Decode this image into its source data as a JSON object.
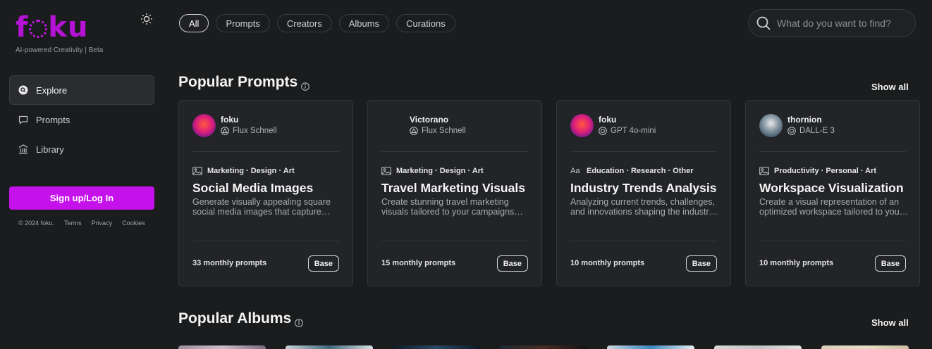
{
  "brand": {
    "logo_text_pre": "f",
    "logo_text_post": "ku",
    "tagline": "AI-powered Creativity | Beta",
    "accent": "#c511ea"
  },
  "sidebar": {
    "items": [
      {
        "label": "Explore",
        "icon": "explore-icon",
        "active": true
      },
      {
        "label": "Prompts",
        "icon": "chat-bubble-icon",
        "active": false
      },
      {
        "label": "Library",
        "icon": "library-icon",
        "active": false
      }
    ],
    "signup_label": "Sign up/Log In",
    "footer": {
      "copyright": "© 2024 foku.",
      "terms": "Terms",
      "privacy": "Privacy",
      "cookies": "Cookies"
    }
  },
  "tabs": [
    {
      "label": "All",
      "active": true
    },
    {
      "label": "Prompts",
      "active": false
    },
    {
      "label": "Creators",
      "active": false
    },
    {
      "label": "Albums",
      "active": false
    },
    {
      "label": "Curations",
      "active": false
    }
  ],
  "search": {
    "placeholder": "What do you want to find?"
  },
  "popular_prompts": {
    "title": "Popular Prompts",
    "show_all": "Show all",
    "cards": [
      {
        "author": "foku",
        "model": "Flux Schnell",
        "categories": "Marketing · Design · Art",
        "category_icon": "image-icon",
        "title": "Social Media Images",
        "description": "Generate visually appealing square social media images that capture attention and engage your audience",
        "monthly": "33 monthly prompts",
        "badge": "Base"
      },
      {
        "author": "Victorano",
        "model": "Flux Schnell",
        "categories": "Marketing · Design · Art",
        "category_icon": "image-icon",
        "title": "Travel Marketing Visuals",
        "description": "Create stunning travel marketing visuals tailored to your campaigns and destinations",
        "monthly": "15 monthly prompts",
        "badge": "Base"
      },
      {
        "author": "foku",
        "model": "GPT 4o-mini",
        "categories": "Education · Research · Other",
        "category_icon": "text-icon",
        "title": "Industry Trends Analysis",
        "description": "Analyzing current trends, challenges, and innovations shaping the industry today",
        "monthly": "10 monthly prompts",
        "badge": "Base"
      },
      {
        "author": "thornion",
        "model": "DALL-E 3",
        "categories": "Productivity · Personal · Art",
        "category_icon": "image-icon",
        "title": "Workspace Visualization",
        "description": "Create a visual representation of an optimized workspace tailored to your needs",
        "monthly": "10 monthly prompts",
        "badge": "Base"
      }
    ]
  },
  "popular_albums": {
    "title": "Popular Albums",
    "show_all": "Show all"
  }
}
